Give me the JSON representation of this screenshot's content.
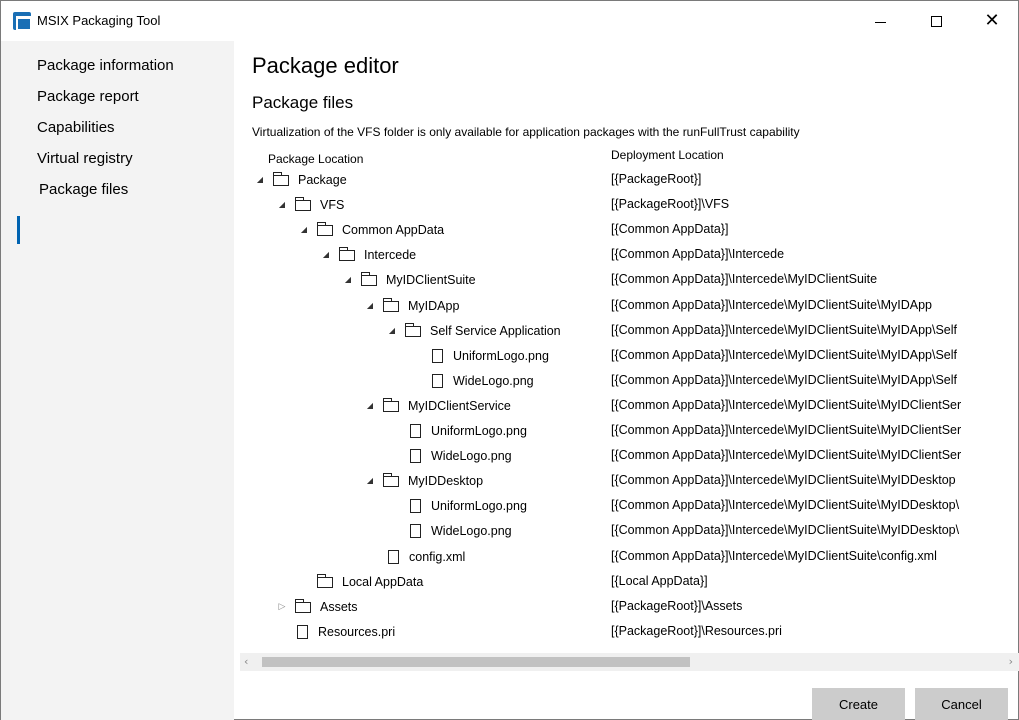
{
  "window": {
    "title": "MSIX Packaging Tool",
    "controls": {
      "minimize": "",
      "maximize": "",
      "close": "✕"
    }
  },
  "sidebar": {
    "items": [
      {
        "label": "Package information"
      },
      {
        "label": "Package report"
      },
      {
        "label": "Capabilities"
      },
      {
        "label": "Virtual registry"
      },
      {
        "label": "Package files",
        "selected": true
      }
    ]
  },
  "main": {
    "title": "Package editor",
    "section_title": "Package files",
    "notice": "Virtualization of the VFS folder is only available for application packages with the runFullTrust capability",
    "columns": {
      "location": "Package Location",
      "deployment": "Deployment Location"
    },
    "tree": [
      {
        "label": "Package",
        "type": "folder",
        "expander": "expanded",
        "deployment": "[{PackageRoot}]"
      },
      {
        "label": "VFS",
        "type": "folder",
        "expander": "expanded",
        "deployment": "[{PackageRoot}]\\VFS"
      },
      {
        "label": "Common AppData",
        "type": "folder",
        "expander": "expanded",
        "deployment": "[{Common AppData}]"
      },
      {
        "label": "Intercede",
        "type": "folder",
        "expander": "expanded",
        "deployment": "[{Common AppData}]\\Intercede"
      },
      {
        "label": "MyIDClientSuite",
        "type": "folder",
        "expander": "expanded",
        "deployment": "[{Common AppData}]\\Intercede\\MyIDClientSuite"
      },
      {
        "label": "MyIDApp",
        "type": "folder",
        "expander": "expanded",
        "deployment": "[{Common AppData}]\\Intercede\\MyIDClientSuite\\MyIDApp"
      },
      {
        "label": "Self Service Application",
        "type": "folder",
        "expander": "expanded",
        "deployment": "[{Common AppData}]\\Intercede\\MyIDClientSuite\\MyIDApp\\Self"
      },
      {
        "label": "UniformLogo.png",
        "type": "file",
        "deployment": "[{Common AppData}]\\Intercede\\MyIDClientSuite\\MyIDApp\\Self"
      },
      {
        "label": "WideLogo.png",
        "type": "file",
        "deployment": "[{Common AppData}]\\Intercede\\MyIDClientSuite\\MyIDApp\\Self"
      },
      {
        "label": "MyIDClientService",
        "type": "folder",
        "expander": "expanded",
        "deployment": "[{Common AppData}]\\Intercede\\MyIDClientSuite\\MyIDClientSer"
      },
      {
        "label": "UniformLogo.png",
        "type": "file",
        "deployment": "[{Common AppData}]\\Intercede\\MyIDClientSuite\\MyIDClientSer"
      },
      {
        "label": "WideLogo.png",
        "type": "file",
        "deployment": "[{Common AppData}]\\Intercede\\MyIDClientSuite\\MyIDClientSer"
      },
      {
        "label": "MyIDDesktop",
        "type": "folder",
        "expander": "expanded",
        "deployment": "[{Common AppData}]\\Intercede\\MyIDClientSuite\\MyIDDesktop"
      },
      {
        "label": "UniformLogo.png",
        "type": "file",
        "deployment": "[{Common AppData}]\\Intercede\\MyIDClientSuite\\MyIDDesktop\\"
      },
      {
        "label": "WideLogo.png",
        "type": "file",
        "deployment": "[{Common AppData}]\\Intercede\\MyIDClientSuite\\MyIDDesktop\\"
      },
      {
        "label": "config.xml",
        "type": "file",
        "deployment": "[{Common AppData}]\\Intercede\\MyIDClientSuite\\config.xml"
      },
      {
        "label": "Local AppData",
        "type": "folder",
        "expander": "none",
        "deployment": "[{Local AppData}]"
      },
      {
        "label": "Assets",
        "type": "folder",
        "expander": "collapsed",
        "deployment": "[{PackageRoot}]\\Assets"
      },
      {
        "label": "Resources.pri",
        "type": "file",
        "deployment": "[{PackageRoot}]\\Resources.pri"
      }
    ]
  },
  "buttons": {
    "create": "Create",
    "cancel": "Cancel"
  },
  "icons": {
    "expanded": "◢",
    "collapsed": "▷",
    "scroll_left": "‹",
    "scroll_right": "›"
  },
  "colors": {
    "accent": "#0063b1",
    "sidebar_bg": "#f3f3f3",
    "button_bg": "#cccccc"
  }
}
